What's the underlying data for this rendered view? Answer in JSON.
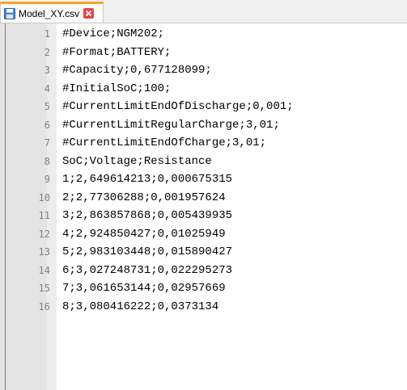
{
  "tab": {
    "filename": "Model_XY.csv",
    "save_icon": "save-icon",
    "close_icon": "close-icon"
  },
  "editor": {
    "lines": [
      {
        "num": "1",
        "text": "#Device;NGM202;"
      },
      {
        "num": "2",
        "text": "#Format;BATTERY;"
      },
      {
        "num": "3",
        "text": "#Capacity;0,677128099;"
      },
      {
        "num": "4",
        "text": "#InitialSoC;100;"
      },
      {
        "num": "5",
        "text": "#CurrentLimitEndOfDischarge;0,001;"
      },
      {
        "num": "6",
        "text": "#CurrentLimitRegularCharge;3,01;"
      },
      {
        "num": "7",
        "text": "#CurrentLimitEndOfCharge;3,01;"
      },
      {
        "num": "8",
        "text": "SoC;Voltage;Resistance"
      },
      {
        "num": "9",
        "text": "1;2,649614213;0,000675315"
      },
      {
        "num": "10",
        "text": "2;2,77306288;0,001957624"
      },
      {
        "num": "11",
        "text": "3;2,863857868;0,005439935"
      },
      {
        "num": "12",
        "text": "4;2,924850427;0,01025949"
      },
      {
        "num": "13",
        "text": "5;2,983103448;0,015890427"
      },
      {
        "num": "14",
        "text": "6;3,027248731;0,022295273"
      },
      {
        "num": "15",
        "text": "7;3,061653144;0,02957669"
      },
      {
        "num": "16",
        "text": "8;3,080416222;0,0373134"
      }
    ]
  }
}
